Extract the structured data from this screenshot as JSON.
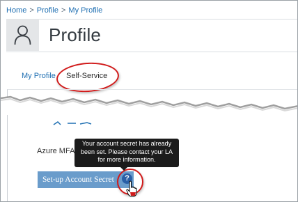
{
  "breadcrumb": {
    "items": [
      "Home",
      "Profile",
      "My Profile"
    ],
    "separator": ">"
  },
  "header": {
    "title": "Profile",
    "avatar_icon": "user-icon"
  },
  "tabs": [
    {
      "label": "My Profile",
      "active": false
    },
    {
      "label": "Self-Service",
      "active": true
    }
  ],
  "self_service": {
    "azure_label": "Azure MFA",
    "setup_button_label": "Set-up Account Secret",
    "help_icon_glyph": "?",
    "tooltip_lines": [
      "Your account secret has already",
      "been set. Please contact your LA",
      "for more information."
    ]
  },
  "colors": {
    "link": "#1f6fb2",
    "button": "#6a9ccb",
    "help_icon": "#2a5fa6",
    "highlight_circle": "#d11a1a",
    "tooltip_bg": "#1b1b1b"
  }
}
